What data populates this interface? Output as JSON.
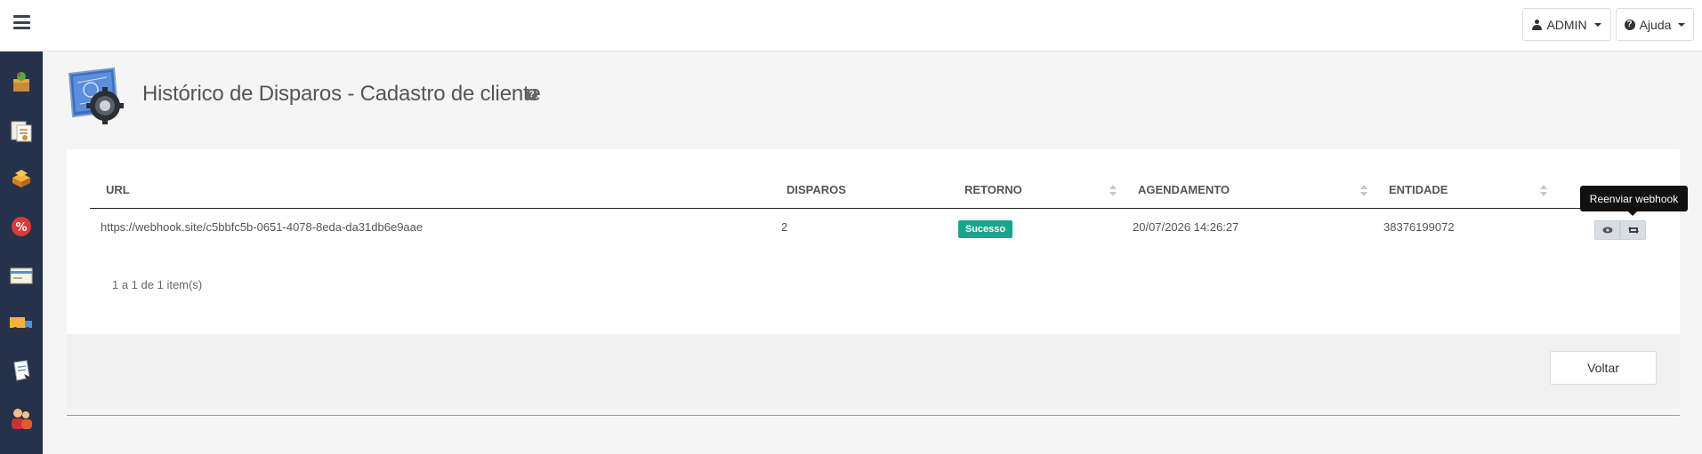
{
  "header": {
    "user_label": "ADMIN",
    "help_label": "Ajuda"
  },
  "page": {
    "title": "Histórico de Disparos - Cadastro de cliente",
    "help_glyph": "?"
  },
  "sidebar": {
    "items": [
      {
        "name": "sidebar-item-products"
      },
      {
        "name": "sidebar-item-documents"
      },
      {
        "name": "sidebar-item-stock"
      },
      {
        "name": "sidebar-item-discounts"
      },
      {
        "name": "sidebar-item-cards"
      },
      {
        "name": "sidebar-item-delivery"
      },
      {
        "name": "sidebar-item-reports"
      },
      {
        "name": "sidebar-item-users"
      }
    ]
  },
  "table": {
    "columns": {
      "url": "URL",
      "disparos": "DISPAROS",
      "retorno": "RETORNO",
      "agendamento": "AGENDAMENTO",
      "entidade": "ENTIDADE"
    },
    "rows": [
      {
        "url": "https://webhook.site/c5bbfc5b-0651-4078-8eda-da31db6e9aae",
        "disparos": "2",
        "retorno": "Sucesso",
        "agendamento": "20/07/2026 14:26:27",
        "entidade": "38376199072"
      }
    ],
    "pagination": "1 a 1 de 1 item(s)"
  },
  "tooltip": "Reenviar webhook",
  "footer": {
    "back_label": "Voltar"
  },
  "colors": {
    "sidebar": "#26324a",
    "success": "#17a68d",
    "tooltip": "#111111"
  },
  "icons": {
    "menu": "hamburger-icon",
    "user": "user-icon",
    "help": "question-circle-icon",
    "view": "eye-icon",
    "resend": "retweet-icon"
  }
}
